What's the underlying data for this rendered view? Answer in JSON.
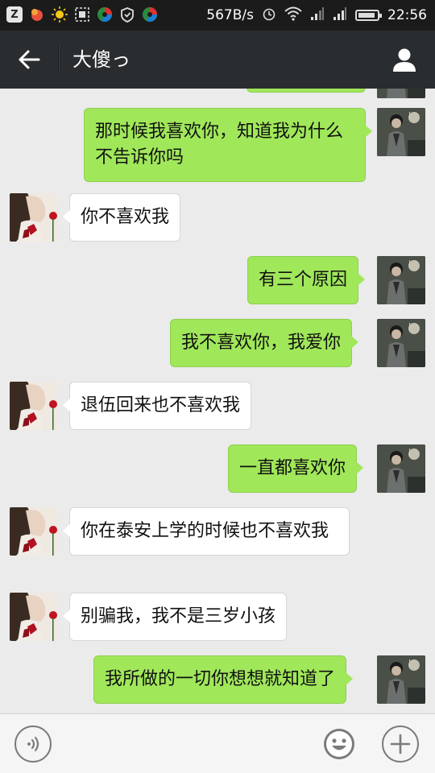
{
  "status_bar": {
    "network_speed": "567B/s",
    "time": "22:56",
    "battery_level": 0.9,
    "icons": [
      "zhihu-icon",
      "app-icon",
      "sun-icon",
      "screenshot-icon",
      "browser-icon",
      "shield-icon",
      "browser-icon",
      "alarm-icon",
      "wifi-icon",
      "signal-icon",
      "signal-icon",
      "battery-icon"
    ]
  },
  "header": {
    "title": "大傻っ",
    "back_icon": "arrow-left-icon",
    "profile_icon": "person-icon"
  },
  "messages": [
    {
      "side": "right",
      "text": ""
    },
    {
      "side": "right",
      "text": "那时候我喜欢你，知道我为什么不告诉你吗"
    },
    {
      "side": "left",
      "text": "你不喜欢我"
    },
    {
      "side": "right",
      "text": "有三个原因"
    },
    {
      "side": "right",
      "text": "我不喜欢你，我爱你"
    },
    {
      "side": "left",
      "text": "退伍回来也不喜欢我"
    },
    {
      "side": "right",
      "text": "一直都喜欢你"
    },
    {
      "side": "left",
      "text": "你在泰安上学的时候也不喜欢我"
    },
    {
      "side": "left",
      "text": "别骗我，我不是三岁小孩"
    },
    {
      "side": "right",
      "text": "我所做的一切你想想就知道了"
    }
  ],
  "input_bar": {
    "value": "",
    "voice_icon": "voice-icon",
    "emoji_icon": "emoji-icon",
    "plus_icon": "plus-icon"
  },
  "colors": {
    "self_bubble": "#a0e75a",
    "other_bubble": "#ffffff",
    "header_bg": "#2a2d2f",
    "chat_bg": "#ebebeb"
  }
}
